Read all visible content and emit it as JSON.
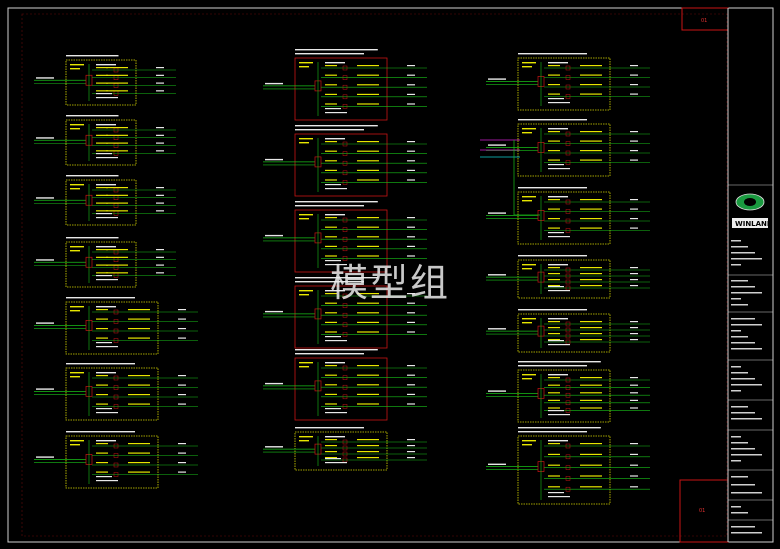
{
  "watermark": "模型组",
  "title_block": {
    "brand": "WINLAND",
    "sheet_tag_top": "01",
    "sheet_tag_bottom": "01"
  },
  "colors": {
    "background": "#000000",
    "frame": "#d0d0d0",
    "box_yellow": "#d8d800",
    "box_red": "#c81414",
    "line_green": "#18c018",
    "text_yellow": "#e6e600",
    "text_white": "#e8e8e8",
    "magenta": "#d020d0",
    "cyan": "#10d0d0"
  }
}
